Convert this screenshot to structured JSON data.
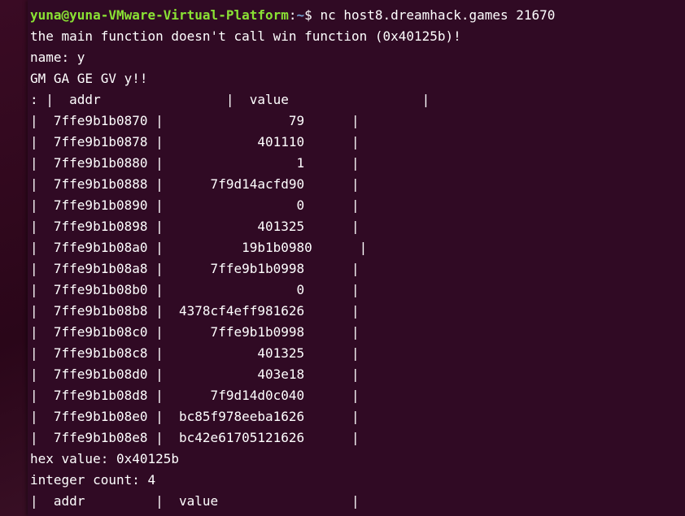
{
  "prompt": {
    "user_host": "yuna@yuna-VMware-Virtual-Platform",
    "separator": ":",
    "path": "~",
    "symbol": "$ ",
    "command": "nc host8.dreamhack.games 21670"
  },
  "output": {
    "message": "the main function doesn't call win function (0x40125b)!",
    "name_line": "name: y",
    "greeting": "GM GA GE GV y!!",
    "table_header": ": |  addr                |  value                 |",
    "rows": [
      "|  7ffe9b1b0870 |                79      |",
      "|  7ffe9b1b0878 |            401110      |",
      "|  7ffe9b1b0880 |                 1      |",
      "|  7ffe9b1b0888 |      7f9d14acfd90      |",
      "|  7ffe9b1b0890 |                 0      |",
      "|  7ffe9b1b0898 |            401325      |",
      "|  7ffe9b1b08a0 |          19b1b0980      |",
      "|  7ffe9b1b08a8 |      7ffe9b1b0998      |",
      "|  7ffe9b1b08b0 |                 0      |",
      "|  7ffe9b1b08b8 |  4378cf4eff981626      |",
      "|  7ffe9b1b08c0 |      7ffe9b1b0998      |",
      "|  7ffe9b1b08c8 |            401325      |",
      "|  7ffe9b1b08d0 |            403e18      |",
      "|  7ffe9b1b08d8 |      7f9d14d0c040      |",
      "|  7ffe9b1b08e0 |  bc85f978eeba1626      |",
      "|  7ffe9b1b08e8 |  bc42e61705121626      |"
    ],
    "hex_value": "hex value: 0x40125b",
    "integer_count": "integer count: 4",
    "table2_header": "|  addr         |  value                 |"
  }
}
